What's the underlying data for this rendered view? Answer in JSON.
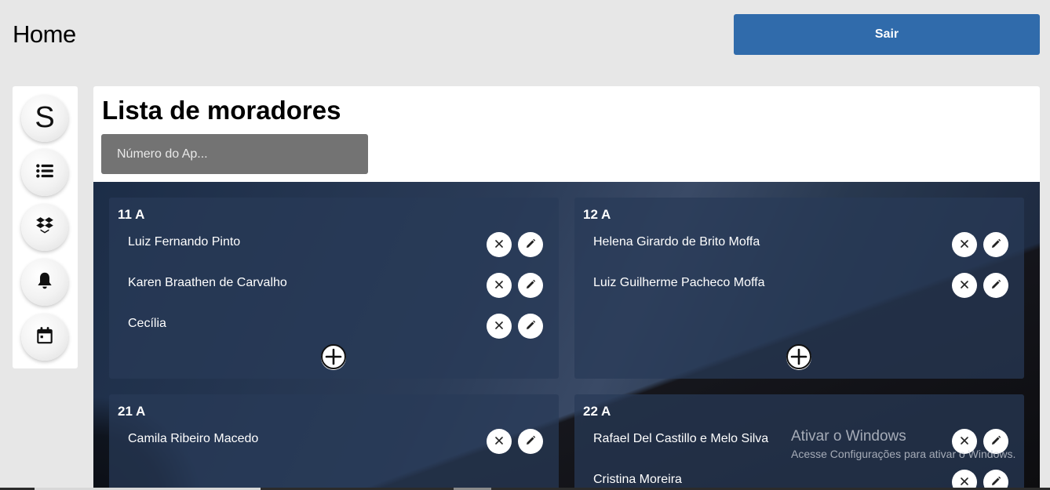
{
  "header": {
    "title": "Home",
    "logout_label": "Sair"
  },
  "sidebar": {
    "items": [
      {
        "label": "S",
        "icon": "avatar-letter"
      },
      {
        "icon": "list-icon"
      },
      {
        "icon": "dropbox-icon"
      },
      {
        "icon": "bell-icon"
      },
      {
        "icon": "calendar-icon"
      }
    ]
  },
  "main": {
    "title": "Lista de moradores",
    "search_placeholder": "Número do Ap..."
  },
  "apartments": [
    {
      "title": "11 A",
      "residents": [
        "Luiz Fernando Pinto",
        "Karen Braathen de Carvalho",
        "Cecília"
      ]
    },
    {
      "title": "12 A",
      "residents": [
        "Helena Girardo de Brito Moffa",
        "Luiz Guilherme Pacheco Moffa"
      ]
    },
    {
      "title": "21 A",
      "residents": [
        "Camila Ribeiro Macedo"
      ]
    },
    {
      "title": "22 A",
      "residents": [
        "Rafael Del Castillo e Melo Silva",
        "Cristina Moreira"
      ]
    }
  ],
  "watermark": {
    "title": "Ativar o Windows",
    "subtitle": "Acesse Configurações para ativar o Windows."
  },
  "colors": {
    "accent": "#306bab",
    "search_bg": "#737373"
  }
}
